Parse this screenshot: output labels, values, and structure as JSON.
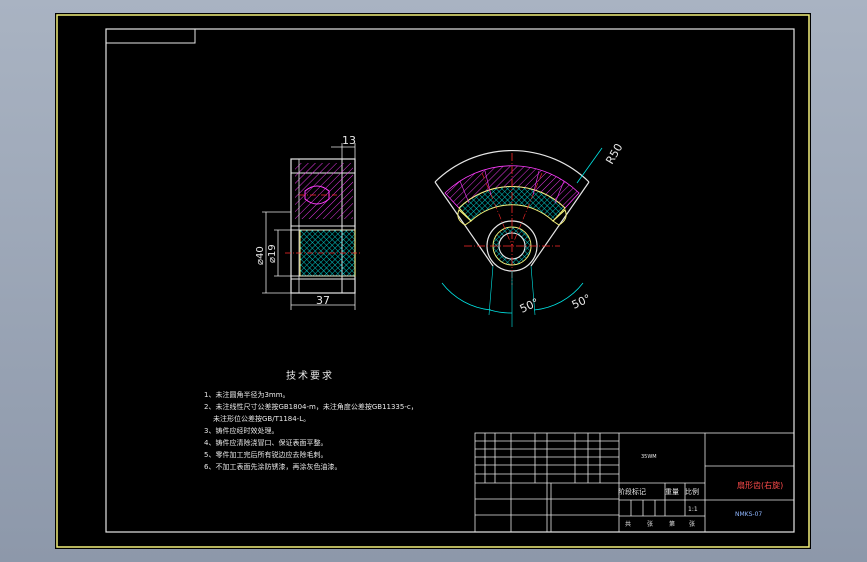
{
  "dimensions": {
    "width_top": "13",
    "outer_dia": "⌀40",
    "inner_dia": "⌀19",
    "length": "37",
    "radius": "R50",
    "angle_left": "50°",
    "angle_right": "50°"
  },
  "technical_requirements": {
    "heading": "技术要求",
    "items": [
      "1、未注圆角半径为3mm。",
      "2、未注线性尺寸公差按GB1804-m，未注角度公差按GB11335-c，",
      "未注形位公差按GB/T1184-L。",
      "3、铸件应经时效处理。",
      "4、铸件应清除浇冒口、保证表面平整。",
      "5、零件加工完后所有锐边应去除毛刺。",
      "6、不加工表面先涂防锈漆，再涂灰色油漆。"
    ]
  },
  "title_block": {
    "part_name": "扇形齿(右旋)",
    "drawing_number": "NMKS-07",
    "material_cell": "35WM",
    "scale": "1:1",
    "header_labels": [
      "阶段标记",
      "重量",
      "比例"
    ],
    "sign_labels": [
      "共",
      "张",
      "第",
      "张"
    ]
  },
  "colors": {
    "background": "#000000",
    "frame": "#e6e6e6",
    "outline": "#f2ef7a",
    "centerline": "#ff2a2a",
    "dimension": "#00e6e6",
    "hatch": "#ff3cff",
    "fill": "#00d8d8",
    "part_name": "#ff3a3a"
  }
}
